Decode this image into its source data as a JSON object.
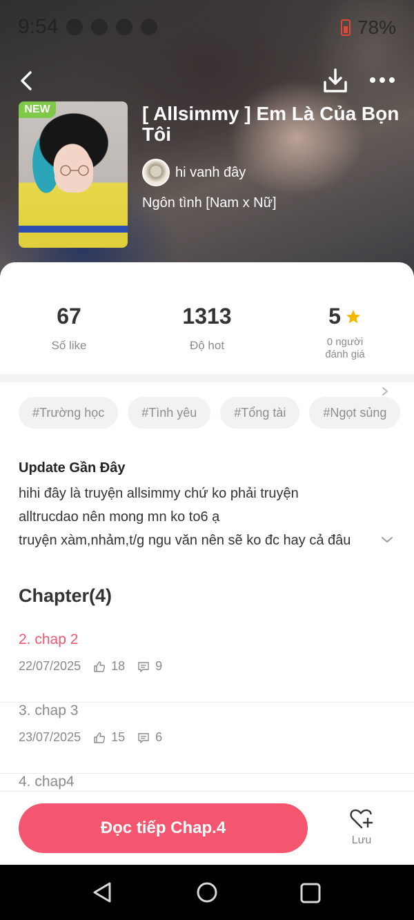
{
  "status_bar": {
    "time": "9:54",
    "battery": "78%"
  },
  "header": {
    "badge": "NEW",
    "title": "[ Allsimmy ] Em Là Của Bọn Tôi",
    "author": "hi vanh đây",
    "genre": "Ngôn tình [Nam x Nữ]"
  },
  "stats": {
    "likes": {
      "value": "67",
      "label": "Số like"
    },
    "hot": {
      "value": "1313",
      "label": "Độ hot"
    },
    "rating": {
      "value": "5",
      "label_line1": "0 người",
      "label_line2": "đánh giá"
    }
  },
  "tags": [
    "#Trường học",
    "#Tình yêu",
    "#Tổng tài",
    "#Ngọt sủng"
  ],
  "update": {
    "title": "Update Gần Đây",
    "line1": "hihi đây là truyện allsimmy chứ ko phải truyện",
    "line2": "alltrucdao nên mong mn ko to6 ạ",
    "line3": "truyện xàm,nhảm,t/g ngu văn nên sẽ ko đc hay cả đâu"
  },
  "chapters": {
    "heading": "Chapter(4)",
    "items": [
      {
        "title": "2. chap 2",
        "date": "22/07/2025",
        "likes": "18",
        "comments": "9",
        "active": true
      },
      {
        "title": "3. chap 3",
        "date": "23/07/2025",
        "likes": "15",
        "comments": "6",
        "active": false
      },
      {
        "title": "4. chap4",
        "date": "",
        "likes": "",
        "comments": "",
        "active": false
      }
    ]
  },
  "actions": {
    "read_label": "Đọc tiếp Chap.4",
    "save_label": "Lưu"
  },
  "colors": {
    "accent": "#f4566f",
    "new_badge": "#7fc94a",
    "star": "#f5b800"
  },
  "icons": {
    "back": "chevron-left-icon",
    "download": "download-icon",
    "more": "more-dots-icon",
    "star": "star-icon",
    "like": "thumbs-up-icon",
    "comment": "comment-icon",
    "save": "heart-plus-icon"
  }
}
